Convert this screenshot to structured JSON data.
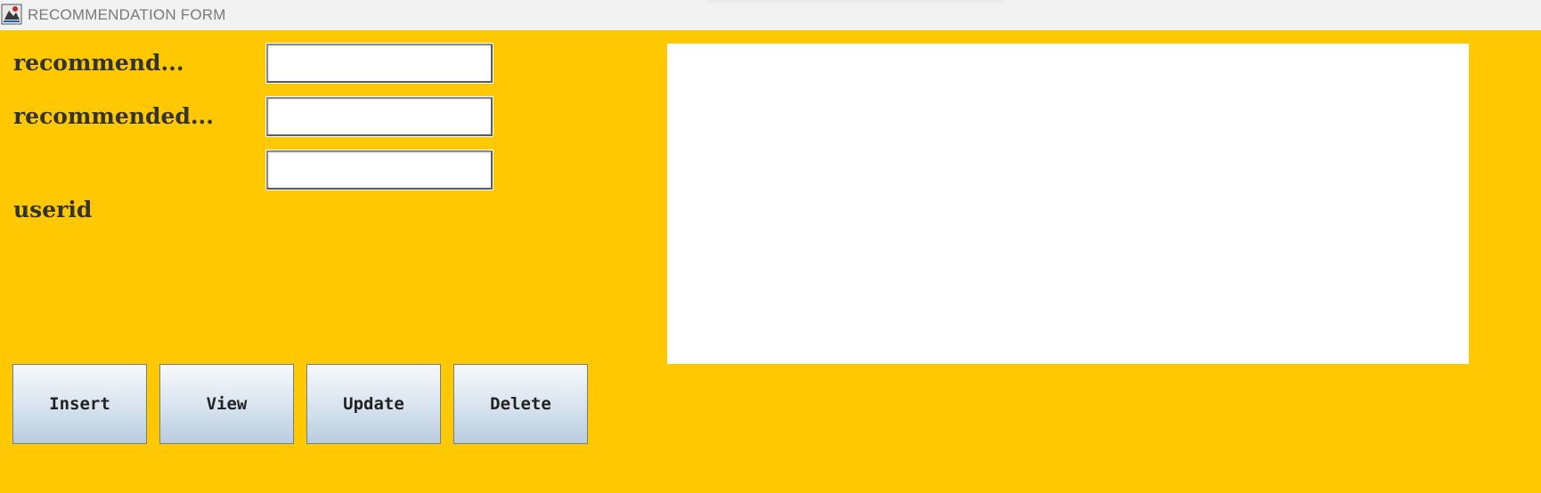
{
  "window": {
    "title": "RECOMMENDATION FORM",
    "icon": "java-app-icon"
  },
  "form": {
    "labels": {
      "recommend": "recommend...",
      "recommended": "recommended...",
      "userid": "userid"
    },
    "fields": {
      "recommend_value": "",
      "recommended_value": "",
      "userid_value": ""
    }
  },
  "buttons": {
    "insert": "Insert",
    "view": "View",
    "update": "Update",
    "delete": "Delete"
  },
  "colors": {
    "background": "#ffc800",
    "label_text": "#333333",
    "button_gradient_top": "#f7f9fb",
    "button_gradient_bottom": "#b9cde0"
  }
}
